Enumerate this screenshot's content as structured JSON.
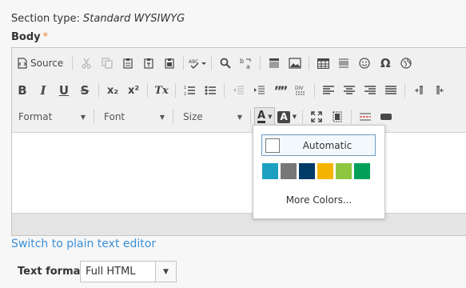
{
  "section": {
    "label": "Section type:",
    "value": "Standard WYSIWYG"
  },
  "body_field": {
    "label": "Body",
    "required_mark": "*"
  },
  "toolbar": {
    "source_label": "Source",
    "format_label": "Format",
    "font_label": "Font",
    "size_label": "Size",
    "bold": "B",
    "italic": "I",
    "underline": "U",
    "strike": "S",
    "subscript": "x₂",
    "superscript": "x²",
    "remove_format": "Tx",
    "blockquote": "””",
    "special_char": "Ω",
    "text_color_glyph": "A",
    "bg_color_glyph": "A"
  },
  "color_panel": {
    "automatic_label": "Automatic",
    "more_colors_label": "More Colors...",
    "swatches": [
      "#1ba1bf",
      "#777777",
      "#003a67",
      "#f5b400",
      "#8dc63f",
      "#00a05a"
    ]
  },
  "switch_link": "Switch to plain text editor",
  "text_format": {
    "label": "Text format",
    "value": "Full HTML"
  }
}
